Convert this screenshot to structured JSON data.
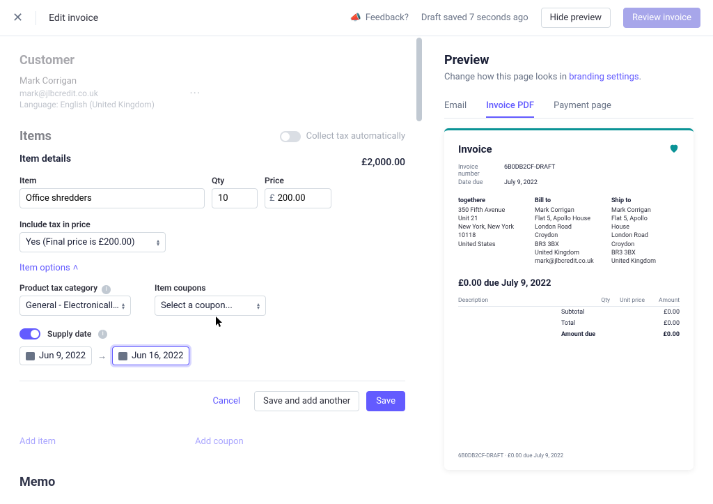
{
  "topbar": {
    "title": "Edit invoice",
    "feedback_label": "Feedback?",
    "draft_saved": "Draft saved 7 seconds ago",
    "hide_preview_label": "Hide preview",
    "review_invoice_label": "Review invoice"
  },
  "customer": {
    "heading": "Customer",
    "name": "Mark Corrigan",
    "email": "mark@jlbcredit.co.uk",
    "language": "Language: English (United Kingdom)"
  },
  "items": {
    "heading": "Items",
    "collect_tax_label": "Collect tax automatically",
    "details_heading": "Item details",
    "total_display": "£2,000.00",
    "labels": {
      "item": "Item",
      "qty": "Qty",
      "price": "Price"
    },
    "item_name": "Office shredders",
    "qty": "10",
    "price_value": "200.00",
    "currency_symbol": "£",
    "include_tax_label": "Include tax in price",
    "include_tax_value": "Yes (Final price is £200.00)",
    "item_options_label": "Item options",
    "product_tax_label": "Product tax category",
    "product_tax_value": "General - Electronically ...",
    "item_coupons_label": "Item coupons",
    "item_coupons_value": "Select a coupon...",
    "supply_date_label": "Supply date",
    "date_from": "Jun 9, 2022",
    "date_to": "Jun 16, 2022",
    "actions": {
      "cancel": "Cancel",
      "save_another": "Save and add another",
      "save": "Save"
    },
    "add_item": "Add item",
    "add_coupon": "Add coupon"
  },
  "memo": {
    "heading": "Memo"
  },
  "preview": {
    "heading": "Preview",
    "subtext_prefix": "Change how this page looks in ",
    "branding_link": "branding settings",
    "tabs": {
      "email": "Email",
      "pdf": "Invoice PDF",
      "payment": "Payment page"
    }
  },
  "pdf": {
    "title": "Invoice",
    "invoice_number_label": "Invoice number",
    "invoice_number": "6B0DB2CF-DRAFT",
    "date_due_label": "Date due",
    "date_due": "July 9, 2022",
    "from": {
      "name": "togethere",
      "line1": "350 Fifth Avenue",
      "line2": "Unit 21",
      "line3": "New York, New York 10118",
      "line4": "United States"
    },
    "bill_to_label": "Bill to",
    "ship_to_label": "Ship to",
    "bill": {
      "name": "Mark Corrigan",
      "line1": "Flat 5, Apollo House",
      "line2": "London Road",
      "line3": "Croydon",
      "line4": "BR3 3BX",
      "line5": "United Kingdom",
      "line6": "mark@jlbcredit.co.uk"
    },
    "ship": {
      "name": "Mark Corrigan",
      "line1": "Flat 5, Apollo",
      "line2": "House",
      "line3": "London Road",
      "line4": "Croydon",
      "line5": "BR3 3BX",
      "line6": "United Kingdom"
    },
    "due_line": "£0.00 due July 9, 2022",
    "th": {
      "desc": "Description",
      "qty": "Qty",
      "unit": "Unit price",
      "amount": "Amount"
    },
    "subtotal_label": "Subtotal",
    "subtotal_value": "£0.00",
    "total_label": "Total",
    "total_value": "£0.00",
    "amount_due_label": "Amount due",
    "amount_due_value": "£0.00",
    "footer": "6B0DB2CF-DRAFT · £0.00 due July 9, 2022"
  }
}
